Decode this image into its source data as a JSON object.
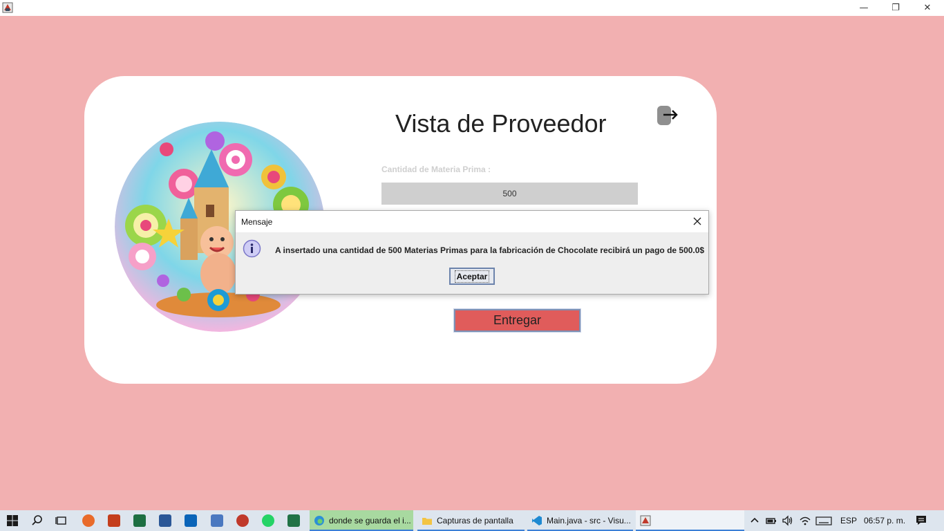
{
  "window": {
    "minimize_glyph": "—",
    "maximize_glyph": "❐",
    "close_glyph": "✕"
  },
  "main": {
    "title": "Vista de Proveedor",
    "quantity_label": "Cantidad de  Materia Prima :",
    "quantity_value": "500",
    "deliver_label": "Entregar"
  },
  "dialog": {
    "title": "Mensaje",
    "message": "A insertado una cantidad de 500 Materias Primas para la fabricación de Chocolate recibirá un pago de 500.0$",
    "ok_label": "Aceptar"
  },
  "taskbar": {
    "tasks": [
      {
        "label": "donde se guarda el i..."
      },
      {
        "label": "Capturas de pantalla"
      },
      {
        "label": "Main.java - src - Visu..."
      }
    ],
    "language": "ESP",
    "time": "06:57 p. m."
  },
  "colors": {
    "background": "#f2b0b1",
    "deliver_button": "#e05c5b",
    "card": "#ffffff"
  }
}
